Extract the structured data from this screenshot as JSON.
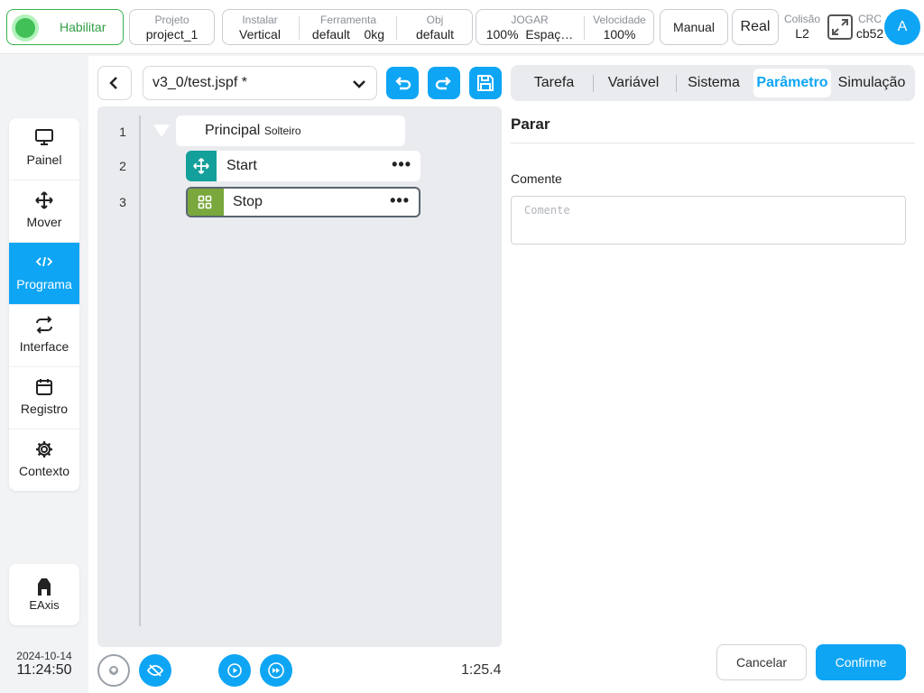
{
  "topbar": {
    "enable_label": "Habilitar",
    "project": {
      "label": "Projeto",
      "value": "project_1"
    },
    "install": {
      "label": "Instalar",
      "value": "Vertical"
    },
    "tool": {
      "label": "Ferramenta",
      "value": "default",
      "weight": "0kg"
    },
    "obj": {
      "label": "Obj",
      "value": "default"
    },
    "jog": {
      "label": "JOGAR",
      "percent": "100%",
      "value": "Espaç…"
    },
    "speed": {
      "label": "Velocidade",
      "value": "100%"
    },
    "manual_label": "Manual",
    "real_label": "Real",
    "collision": {
      "label": "Colisão",
      "value": "L2"
    },
    "crc": {
      "label": "CRC",
      "value": "cb52"
    },
    "avatar": "A",
    "accent": "#0ea5f4",
    "enable_color": "#40c057"
  },
  "sidebar": {
    "items": [
      {
        "label": "Painel",
        "icon": "monitor-icon"
      },
      {
        "label": "Mover",
        "icon": "move-arrows-icon"
      },
      {
        "label": "Programa",
        "icon": "code-icon"
      },
      {
        "label": "Interface",
        "icon": "repeat-arrows-icon"
      },
      {
        "label": "Registro",
        "icon": "calendar-icon"
      },
      {
        "label": "Contexto",
        "icon": "gear-icon"
      }
    ],
    "active_index": 2,
    "eaxis_label": "EAxis",
    "date": "2024-10-14",
    "time": "11:24:50"
  },
  "program": {
    "file": "v3_0/test.jspf *",
    "lines": [
      "1",
      "2",
      "3"
    ],
    "main_node": {
      "label": "Principal",
      "sub": "Solteiro"
    },
    "nodes": [
      {
        "label": "Start",
        "icon": "move-arrows-icon",
        "color": "#14a09a"
      },
      {
        "label": "Stop",
        "icon": "grid-icon",
        "color": "#7aa83c"
      }
    ],
    "selected_index": 1,
    "more": "•••",
    "elapsed": "1:25.4"
  },
  "panel": {
    "tabs": [
      "Tarefa",
      "Variável",
      "Sistema",
      "Parâmetro",
      "Simulação"
    ],
    "active_tab": 3,
    "title": "Parar",
    "comment_label": "Comente",
    "comment_placeholder": "Comente",
    "comment_value": "",
    "cancel_label": "Cancelar",
    "confirm_label": "Confirme"
  }
}
